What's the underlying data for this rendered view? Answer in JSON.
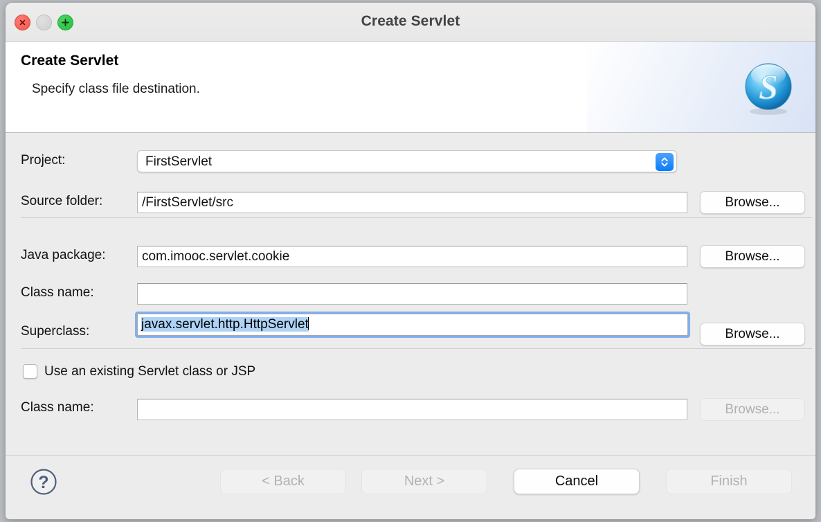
{
  "window": {
    "title": "Create Servlet",
    "controls": {
      "close": "close-button",
      "minimize": "minimize-button",
      "zoom": "zoom-button"
    }
  },
  "header": {
    "title": "Create Servlet",
    "subtitle": "Specify class file destination.",
    "icon": "servlet-s-icon"
  },
  "form": {
    "project": {
      "label": "Project:",
      "value": "FirstServlet",
      "control": "combobox"
    },
    "source_folder": {
      "label": "Source folder:",
      "value": "/FirstServlet/src",
      "browse_label": "Browse...",
      "browse_enabled": true
    },
    "java_package": {
      "label": "Java package:",
      "value": "com.imooc.servlet.cookie",
      "browse_label": "Browse...",
      "browse_enabled": true
    },
    "class_name": {
      "label": "Class name:",
      "value": ""
    },
    "superclass": {
      "label": "Superclass:",
      "value": "javax.servlet.http.HttpServlet",
      "focused": true,
      "selected": true,
      "browse_label": "Browse...",
      "browse_enabled": true
    },
    "use_existing": {
      "label": "Use an existing Servlet class or JSP",
      "checked": false
    },
    "existing_class_name": {
      "label": "Class name:",
      "value": "",
      "browse_label": "Browse...",
      "browse_enabled": false
    }
  },
  "footer": {
    "help": "help-button",
    "back": {
      "label": "< Back",
      "enabled": false
    },
    "next": {
      "label": "Next >",
      "enabled": false
    },
    "cancel": {
      "label": "Cancel",
      "enabled": true
    },
    "finish": {
      "label": "Finish",
      "enabled": false
    }
  },
  "colors": {
    "accent_blue": "#0a7dfb",
    "focus_ring": "#82aeee",
    "selection": "#aed3f7",
    "window_bg": "#ececec",
    "close_red": "#f0574e",
    "zoom_green": "#23c03c",
    "help_slate": "#4e5f7d"
  }
}
